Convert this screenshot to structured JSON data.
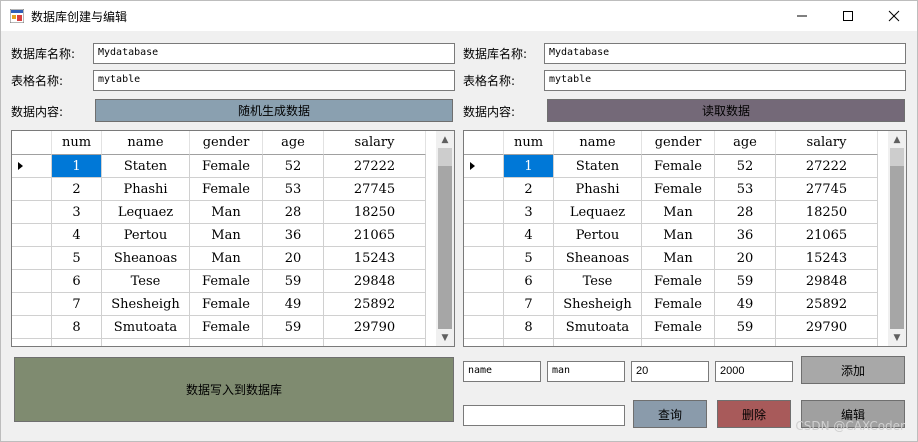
{
  "window": {
    "title": "数据库创建与编辑"
  },
  "left": {
    "db_label": "数据库名称:",
    "db_value": "Mydatabase",
    "table_label": "表格名称:",
    "table_value": "mytable",
    "content_label": "数据内容:",
    "action_button": "随机生成数据",
    "write_button": "数据写入到数据库"
  },
  "right": {
    "db_label": "数据库名称:",
    "db_value": "Mydatabase",
    "table_label": "表格名称:",
    "table_value": "mytable",
    "content_label": "数据内容:",
    "action_button": "读取数据"
  },
  "editor": {
    "name_value": "name",
    "gender_value": "man",
    "age_value": "20",
    "salary_value": "2000",
    "add_button": "添加",
    "query_value": "",
    "query_button": "查询",
    "delete_button": "删除",
    "edit_button": "编辑"
  },
  "grid": {
    "columns": [
      "num",
      "name",
      "gender",
      "age",
      "salary"
    ],
    "rows": [
      [
        "1",
        "Staten",
        "Female",
        "52",
        "27222"
      ],
      [
        "2",
        "Phashi",
        "Female",
        "53",
        "27745"
      ],
      [
        "3",
        "Lequaez",
        "Man",
        "28",
        "18250"
      ],
      [
        "4",
        "Pertou",
        "Man",
        "36",
        "21065"
      ],
      [
        "5",
        "Sheanoas",
        "Man",
        "20",
        "15243"
      ],
      [
        "6",
        "Tese",
        "Female",
        "59",
        "29848"
      ],
      [
        "7",
        "Shesheigh",
        "Female",
        "49",
        "25892"
      ],
      [
        "8",
        "Smutoata",
        "Female",
        "59",
        "29790"
      ]
    ]
  },
  "watermark": "CSDN @CAXCoder",
  "colors": {
    "random_btn": "#8aa0b0",
    "read_btn": "#746978",
    "write_btn": "#7f8b70",
    "add_btn": "#a8a8a8",
    "query_btn": "#8a9bab",
    "delete_btn": "#a85a5a",
    "edit_btn": "#a0a0a0",
    "selection": "#0078d7"
  }
}
